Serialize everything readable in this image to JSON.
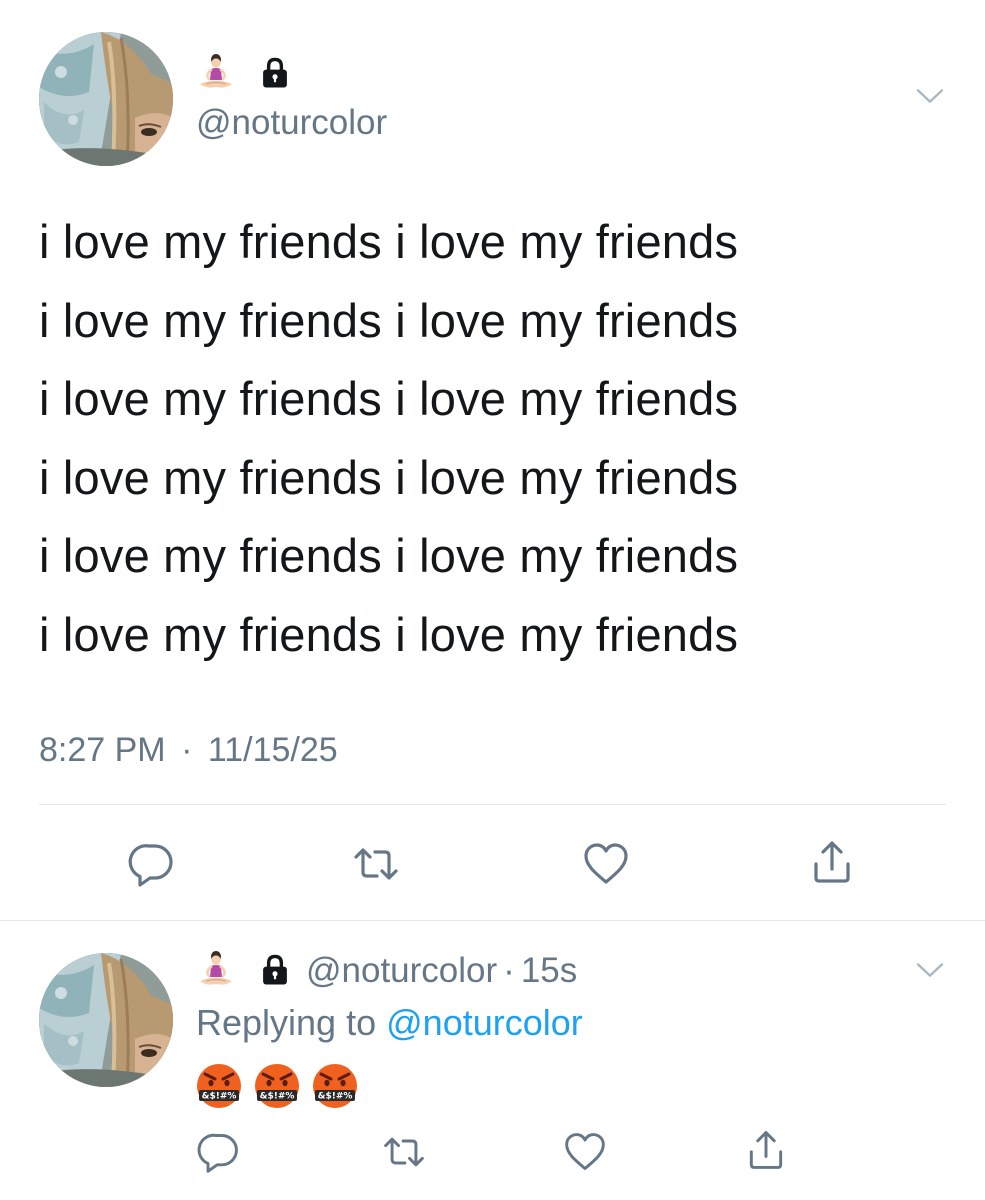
{
  "main_tweet": {
    "handle": "@noturcolor",
    "lines": [
      "i love my friends i love my friends",
      "i love my friends i love my friends",
      "i love my friends i love my friends",
      "i love my friends i love my friends",
      "i love my friends i love my friends",
      "i love my friends i love my friends"
    ],
    "time": "8:27 PM",
    "separator": "·",
    "date": "11/15/25"
  },
  "reply_tweet": {
    "handle": "@noturcolor",
    "separator": "·",
    "age": "15s",
    "replying_prefix": "Replying to",
    "replying_handle": "@noturcolor",
    "emoji_text": "&$!#%"
  },
  "icons": {
    "name_emoji": "person-in-lotus-position-icon",
    "lock": "lock-icon",
    "more": "chevron-down-icon",
    "actions": [
      "reply-icon",
      "retweet-icon",
      "like-icon",
      "share-icon"
    ],
    "reaction": "face-with-symbols-on-mouth-icon"
  },
  "colors": {
    "text": "#14171a",
    "secondary": "#657786",
    "link": "#1da1f2",
    "divider": "#e1e8ed",
    "emoji_face": "#f0601e"
  }
}
